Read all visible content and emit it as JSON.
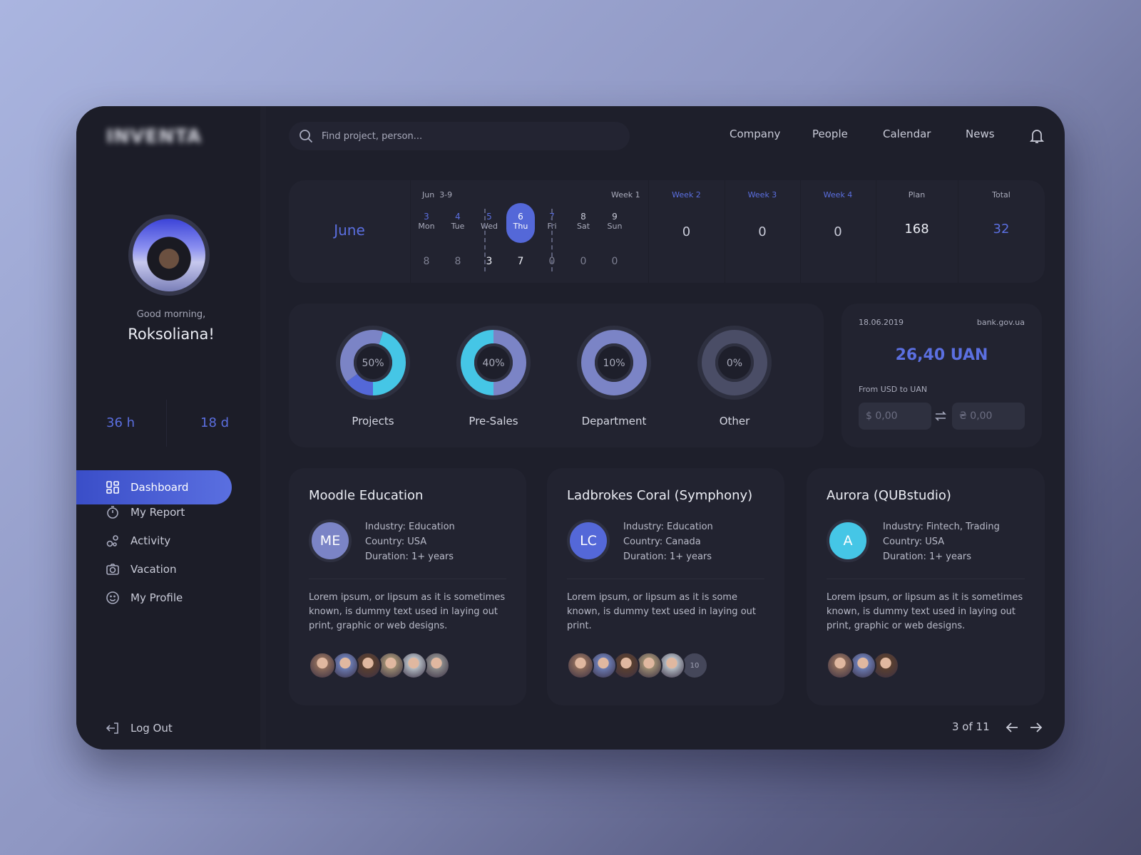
{
  "brand": {
    "logo": "INVENTA"
  },
  "colors": {
    "accent": "#5468d8",
    "cyan": "#45c6e6",
    "lavender": "#7b84c6",
    "gray": "#4a4d66"
  },
  "user": {
    "greeting": "Good morning,",
    "name": "Roksoliana!",
    "hours": "36 h",
    "days": "18 d"
  },
  "sidebar": {
    "items": [
      {
        "label": "Dashboard",
        "icon": "dashboard-icon",
        "active": true
      },
      {
        "label": "My Report",
        "icon": "stopwatch-icon"
      },
      {
        "label": "Activity",
        "icon": "activity-icon"
      },
      {
        "label": "Vacation",
        "icon": "camera-icon"
      },
      {
        "label": "My Profile",
        "icon": "smiley-icon"
      }
    ],
    "logout": "Log Out"
  },
  "header": {
    "search_placeholder": "Find project, person...",
    "nav": [
      "Company",
      "People",
      "Calendar",
      "News"
    ]
  },
  "calendar": {
    "month": "June",
    "range_month": "Jun",
    "range": "3-9",
    "week_label": "Week 1",
    "days": [
      {
        "num": "3",
        "name": "Mon",
        "val": "8"
      },
      {
        "num": "4",
        "name": "Tue",
        "val": "8"
      },
      {
        "num": "5",
        "name": "Wed",
        "val": "3"
      },
      {
        "num": "6",
        "name": "Thu",
        "val": "7",
        "selected": true
      },
      {
        "num": "7",
        "name": "Fri",
        "val": "0"
      },
      {
        "num": "8",
        "name": "Sat",
        "val": "0"
      },
      {
        "num": "9",
        "name": "Sun",
        "val": "0"
      }
    ],
    "weeks": [
      {
        "label": "Week 2",
        "val": "0"
      },
      {
        "label": "Week 3",
        "val": "0"
      },
      {
        "label": "Week 4",
        "val": "0"
      }
    ],
    "plan": {
      "label": "Plan",
      "val": "168"
    },
    "total": {
      "label": "Total",
      "val": "32"
    }
  },
  "stats": [
    {
      "label": "Projects",
      "pct": "50%",
      "segments": [
        {
          "color": "#45c6e6",
          "from": 0.05,
          "to": 0.5
        },
        {
          "color": "#5468d8",
          "from": 0.5,
          "to": 0.65
        },
        {
          "color": "#7b84c6",
          "from": 0.65,
          "to": 1.05
        }
      ]
    },
    {
      "label": "Pre-Sales",
      "pct": "40%",
      "segments": [
        {
          "color": "#7b84c6",
          "from": 0,
          "to": 0.5
        },
        {
          "color": "#45c6e6",
          "from": 0.5,
          "to": 1
        }
      ]
    },
    {
      "label": "Department",
      "pct": "10%",
      "segments": [
        {
          "color": "#7b84c6",
          "from": 0,
          "to": 1
        }
      ]
    },
    {
      "label": "Other",
      "pct": "0%",
      "segments": [
        {
          "color": "#4a4d66",
          "from": 0,
          "to": 1
        }
      ]
    }
  ],
  "rate": {
    "date": "18.06.2019",
    "source": "bank.gov.ua",
    "value": "26,40 UAN",
    "label": "From USD to UAN",
    "usd_placeholder": "$ 0,00",
    "uah_placeholder": "₴ 0,00"
  },
  "projects": [
    {
      "title": "Moodle Education",
      "initials": "ME",
      "color": "#7b84c6",
      "industry": "Industry: Education",
      "country": "Country: USA",
      "duration": "Duration: 1+ years",
      "desc": "Lorem ipsum, or lipsum as it is sometimes known, is dummy text used in laying out print, graphic or web designs.",
      "team": 6,
      "more": ""
    },
    {
      "title": "Ladbrokes Coral (Symphony)",
      "initials": "LC",
      "color": "#5468d8",
      "industry": "Industry: Education",
      "country": "Country: Canada",
      "duration": "Duration: 1+ years",
      "desc": "Lorem ipsum, or lipsum as it is some known, is dummy text used in laying out print.",
      "team": 5,
      "more": "10"
    },
    {
      "title": "Aurora (QUBstudio)",
      "initials": "A",
      "color": "#45c6e6",
      "industry": "Industry: Fintech, Trading",
      "country": "Country: USA",
      "duration": "Duration: 1+ years",
      "desc": "Lorem ipsum, or lipsum as it is sometimes known, is dummy text used in laying out print, graphic or web designs.",
      "team": 3,
      "more": ""
    }
  ],
  "pagination": {
    "text": "3 of 11"
  }
}
